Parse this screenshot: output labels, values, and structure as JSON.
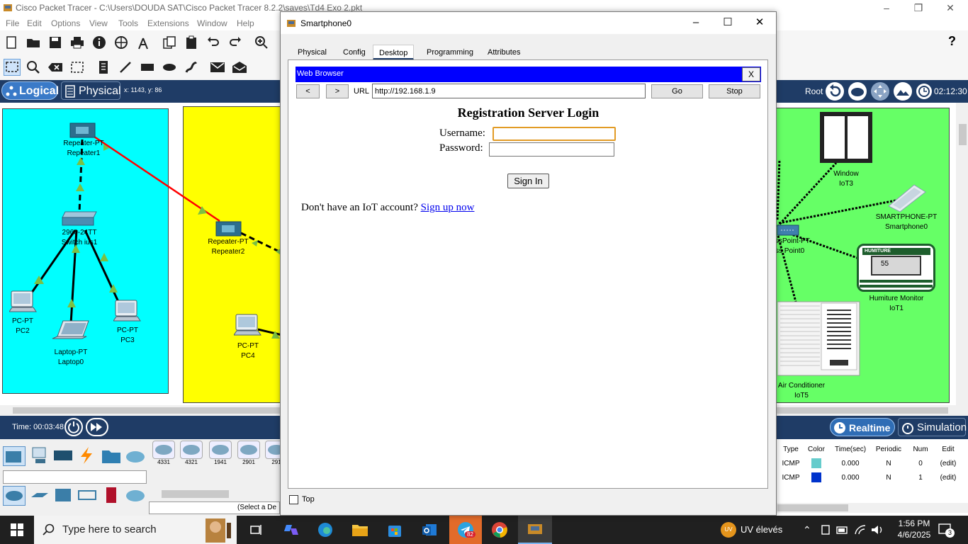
{
  "window": {
    "title": "Cisco Packet Tracer - C:\\Users\\DOUDA SAT\\Cisco Packet Tracer 8.2.2\\saves\\Td4 Exo 2.pkt",
    "controls": [
      "–",
      "❐",
      "✕"
    ]
  },
  "menu": [
    "File",
    "Edit",
    "Options",
    "View",
    "Tools",
    "Extensions",
    "Window",
    "Help"
  ],
  "help_glyph": "?",
  "logical_bar": {
    "logical_label": "Logical",
    "physical_label": "Physical",
    "coords": "x: 1143, y: 86",
    "root_label": "Root",
    "clock": "02:12:30"
  },
  "devices": {
    "repeater1": {
      "type": "Repeater-PT",
      "name": "Repeater1"
    },
    "switch1": {
      "type": "2960-24TT",
      "name": "Switch ius1"
    },
    "pc2": {
      "type": "PC-PT",
      "name": "PC2"
    },
    "laptop0": {
      "type": "Laptop-PT",
      "name": "Laptop0"
    },
    "pc3": {
      "type": "PC-PT",
      "name": "PC3"
    },
    "repeater2": {
      "type": "Repeater-PT",
      "name": "Repeater2"
    },
    "pc4": {
      "type": "PC-PT",
      "name": "PC4"
    },
    "window": {
      "type": "Window",
      "name": "IoT3"
    },
    "smartphone": {
      "type": "SMARTPHONE-PT",
      "name": "Smartphone0"
    },
    "access_point": {
      "type": "ssPoint-PT",
      "name": "ss Point0"
    },
    "humiture": {
      "type": "Humiture Monitor",
      "name": "IoT1",
      "badge": "HUMITURE",
      "reading": "55"
    },
    "air_conditioner": {
      "type": "Air Conditioner",
      "name": "IoT5"
    }
  },
  "simulation_bar": {
    "time": "Time: 00:03:48",
    "realtime_label": "Realtime",
    "simulation_label": "Simulation"
  },
  "device_models": [
    "4331",
    "4321",
    "1941",
    "2901",
    "291"
  ],
  "device_select_hint": "(Select a De",
  "pdu_table": {
    "headers": [
      "Type",
      "Color",
      "Time(sec)",
      "Periodic",
      "Num",
      "Edit"
    ],
    "rows": [
      {
        "type": "ICMP",
        "color": "#66cccc",
        "time": "0.000",
        "periodic": "N",
        "num": "0",
        "edit": "(edit)"
      },
      {
        "type": "ICMP",
        "color": "#0033cc",
        "time": "0.000",
        "periodic": "N",
        "num": "1",
        "edit": "(edit)"
      }
    ]
  },
  "dialog": {
    "title": "Smartphone0",
    "tabs": [
      "Physical",
      "Config",
      "Desktop",
      "Programming",
      "Attributes"
    ],
    "active_tab": "Desktop",
    "browser": {
      "header": "Web Browser",
      "close": "X",
      "back": "<",
      "forward": ">",
      "url_label": "URL",
      "url": "http://192.168.1.9",
      "go": "Go",
      "stop": "Stop"
    },
    "page": {
      "title": "Registration Server Login",
      "username_label": "Username:",
      "username_value": "",
      "password_label": "Password:",
      "password_value": "",
      "signin": "Sign In",
      "signup_prompt": "Don't have an IoT account?",
      "signup_link": "Sign up now"
    },
    "top_checkbox_label": "Top"
  },
  "taskbar": {
    "search_placeholder": "Type here to search",
    "telegram_badge": "82",
    "weather": "UV élevés",
    "weather_badge": "UV",
    "time": "1:56 PM",
    "date": "4/6/2025",
    "notif_count": "3"
  },
  "colors": {
    "accent_bar": "#1f3c66",
    "zone_cyan": "#00ffff",
    "zone_yellow": "#ffff00",
    "zone_green": "#66ff66",
    "browser_header": "#0000ff"
  }
}
